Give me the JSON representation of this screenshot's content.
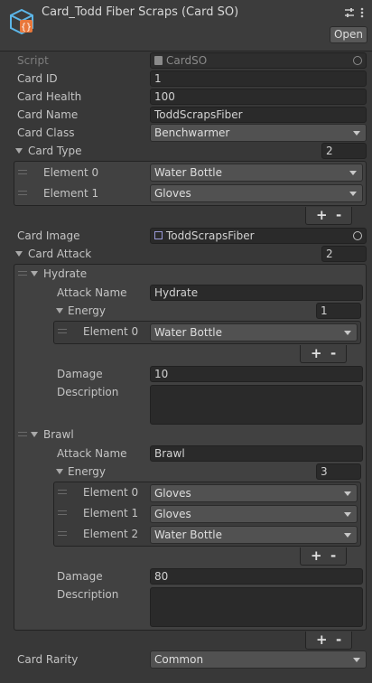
{
  "header": {
    "title": "Card_Todd Fiber Scraps (Card SO)",
    "open_label": "Open"
  },
  "fields": {
    "script": {
      "label": "Script",
      "value": "CardSO"
    },
    "card_id": {
      "label": "Card ID",
      "value": "1"
    },
    "card_health": {
      "label": "Card Health",
      "value": "100"
    },
    "card_name": {
      "label": "Card Name",
      "value": "ToddScrapsFiber"
    },
    "card_class": {
      "label": "Card Class",
      "value": "Benchwarmer"
    },
    "card_type": {
      "label": "Card Type",
      "count": "2",
      "elements": [
        {
          "label": "Element 0",
          "value": "Water Bottle"
        },
        {
          "label": "Element 1",
          "value": "Gloves"
        }
      ]
    },
    "card_image": {
      "label": "Card Image",
      "value": "ToddScrapsFiber"
    },
    "card_attack": {
      "label": "Card Attack",
      "count": "2",
      "attacks": [
        {
          "header": "Hydrate",
          "name_label": "Attack Name",
          "name_value": "Hydrate",
          "energy_label": "Energy",
          "energy_count": "1",
          "energy": [
            {
              "label": "Element 0",
              "value": "Water Bottle"
            }
          ],
          "damage_label": "Damage",
          "damage_value": "10",
          "description_label": "Description"
        },
        {
          "header": "Brawl",
          "name_label": "Attack Name",
          "name_value": "Brawl",
          "energy_label": "Energy",
          "energy_count": "3",
          "energy": [
            {
              "label": "Element 0",
              "value": "Gloves"
            },
            {
              "label": "Element 1",
              "value": "Gloves"
            },
            {
              "label": "Element 2",
              "value": "Water Bottle"
            }
          ],
          "damage_label": "Damage",
          "damage_value": "80",
          "description_label": "Description"
        }
      ]
    },
    "card_rarity": {
      "label": "Card Rarity",
      "value": "Common"
    }
  },
  "list_controls": {
    "add": "+",
    "remove": "-"
  }
}
